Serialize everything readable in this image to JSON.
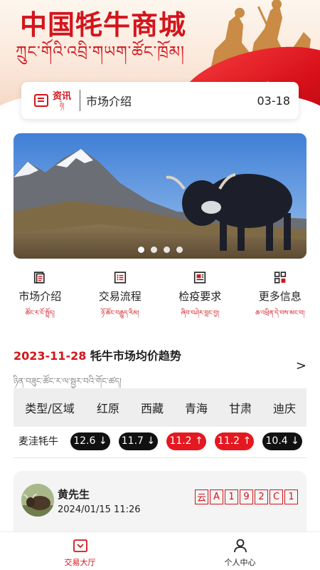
{
  "banner": {
    "title": "中国牦牛商城",
    "subtitle_tibetan": "ཀྲུང་གོའི་འབྲི་གཡག་ཚོང་ཁྲོམ།"
  },
  "news": {
    "tag_cn": "资讯",
    "tag_tb": "ཉེ།",
    "text": "市场介绍",
    "date": "03-18"
  },
  "hero": {
    "dots": 4,
    "active_dot": 0
  },
  "quicknav": [
    {
      "label": "市场介绍",
      "tb": "ཚོང་ར་ངོ་སྤྲོད།",
      "icon": "document-icon"
    },
    {
      "label": "交易流程",
      "tb": "ཉོ་ཚོང་བརྒྱུད་རིམ།",
      "icon": "list-icon"
    },
    {
      "label": "检疫要求",
      "tb": "ཞིབ་བཤེར་བླང་བྱ།",
      "icon": "report-icon"
    },
    {
      "label": "更多信息",
      "tb": "ཆ་འཕྲིན་དེ་བས་མང་བ།",
      "icon": "grid-icon"
    }
  ],
  "trend": {
    "date": "2023-11-28",
    "title": "牦牛市场均价趋势",
    "tibetan": "ཉིན་བཟུང་ཚོང་ར་ལ་སྦྱར་བའི་གོང་ཚད།",
    "arrow": ">"
  },
  "table": {
    "headers": [
      "类型/区域",
      "红原",
      "西藏",
      "青海",
      "甘肃",
      "迪庆"
    ],
    "rows": [
      {
        "name": "麦洼牦牛",
        "cells": [
          {
            "value": "12.6",
            "trend": "down",
            "arrow": "↓"
          },
          {
            "value": "11.7",
            "trend": "down",
            "arrow": "↓"
          },
          {
            "value": "11.2",
            "trend": "up",
            "arrow": "↑"
          },
          {
            "value": "11.2",
            "trend": "up",
            "arrow": "↑"
          },
          {
            "value": "10.4",
            "trend": "down",
            "arrow": "↓"
          }
        ]
      }
    ]
  },
  "post": {
    "user": "黄先生",
    "time": "2024/01/15 11:26",
    "plate": [
      "云",
      "A",
      "1",
      "9",
      "2",
      "C",
      "1"
    ]
  },
  "tabbar": [
    {
      "label": "交易大厅",
      "icon": "market-hall-icon",
      "active": true
    },
    {
      "label": "个人中心",
      "icon": "person-icon",
      "active": false
    }
  ],
  "colors": {
    "accent": "#d4141c",
    "up": "#e41820",
    "down": "#111111"
  }
}
